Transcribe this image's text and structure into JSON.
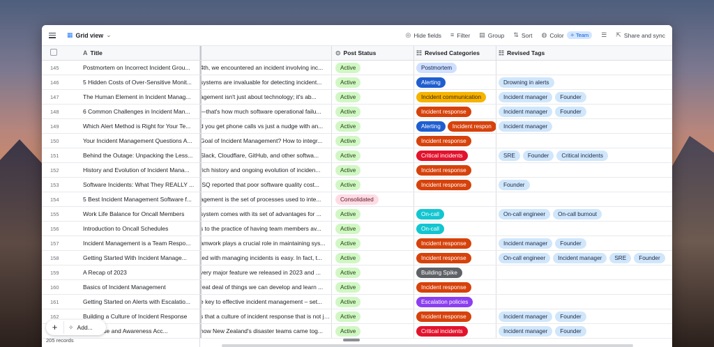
{
  "toolbar": {
    "view_name": "Grid view",
    "hide_fields": "Hide fields",
    "filter": "Filter",
    "group": "Group",
    "sort": "Sort",
    "color": "Color",
    "team_badge": "Team",
    "share": "Share and sync"
  },
  "columns": {
    "title": "Title",
    "status": "Post Status",
    "categories": "Revised Categories",
    "tags": "Revised Tags"
  },
  "rows": [
    {
      "num": "145",
      "title": "Postmortem on Incorrect Incident Grou...",
      "body": "4th, we encountered an incident involving inc...",
      "status": "Active",
      "cats": [
        {
          "t": "Postmortem",
          "c": "p-post"
        }
      ],
      "tags": []
    },
    {
      "num": "146",
      "title": "5 Hidden Costs of Over-Sensitive Monit...",
      "body": "systems are invaluable for detecting incident...",
      "status": "Active",
      "cats": [
        {
          "t": "Alerting",
          "c": "p-alert"
        }
      ],
      "tags": [
        "Drowning in alerts"
      ]
    },
    {
      "num": "147",
      "title": "The Human Element in Incident Manag...",
      "body": "agement isn't just about technology; it's ab...",
      "status": "Active",
      "cats": [
        {
          "t": "Incident communication",
          "c": "p-comm"
        }
      ],
      "tags": [
        "Incident manager",
        "Founder"
      ]
    },
    {
      "num": "148",
      "title": "6 Common Challenges in Incident Man...",
      "body": "—that's how much software operational failu...",
      "status": "Active",
      "cats": [
        {
          "t": "Incident response",
          "c": "p-resp"
        }
      ],
      "tags": [
        "Incident manager",
        "Founder"
      ]
    },
    {
      "num": "149",
      "title": "Which Alert Method is Right for Your Te...",
      "body": "d you get phone calls vs just a nudge with an...",
      "status": "Active",
      "cats": [
        {
          "t": "Alerting",
          "c": "p-alert"
        },
        {
          "t": "Incident respon",
          "c": "p-resp"
        }
      ],
      "tags": [
        "Incident manager"
      ]
    },
    {
      "num": "150",
      "title": "Your Incident Management Questions A...",
      "body": "Goal of Incident Management? How to integr...",
      "status": "Active",
      "cats": [
        {
          "t": "Incident response",
          "c": "p-resp"
        }
      ],
      "tags": []
    },
    {
      "num": "151",
      "title": "Behind the Outage: Unpacking the Less...",
      "body": "Slack, Cloudflare, GitHub, and other softwa...",
      "status": "Active",
      "cats": [
        {
          "t": "Critical incidents",
          "c": "p-crit"
        }
      ],
      "tags": [
        "SRE",
        "Founder",
        "Critical incidents"
      ]
    },
    {
      "num": "152",
      "title": "History and Evolution of Incident Mana...",
      "body": "rich history and ongoing evolution of inciden...",
      "status": "Active",
      "cats": [
        {
          "t": "Incident response",
          "c": "p-resp"
        }
      ],
      "tags": []
    },
    {
      "num": "153",
      "title": "Software Incidents: What They REALLY ...",
      "body": "ISQ reported that poor software quality cost...",
      "status": "Active",
      "cats": [
        {
          "t": "Incident response",
          "c": "p-resp"
        }
      ],
      "tags": [
        "Founder"
      ]
    },
    {
      "num": "154",
      "title": "5 Best Incident Management Software f...",
      "body": "agement is the set of processes used to inte...",
      "status": "Consolidated",
      "cats": [],
      "tags": []
    },
    {
      "num": "155",
      "title": "Work Life Balance for Oncall Members",
      "body": "system comes with its set of advantages for ...",
      "status": "Active",
      "cats": [
        {
          "t": "On-call",
          "c": "p-oncall"
        }
      ],
      "tags": [
        "On-call engineer",
        "On-call burnout"
      ]
    },
    {
      "num": "156",
      "title": "Introduction to Oncall Schedules",
      "body": "s to the practice of having team members av...",
      "status": "Active",
      "cats": [
        {
          "t": "On-call",
          "c": "p-oncall"
        }
      ],
      "tags": []
    },
    {
      "num": "157",
      "title": "Incident Management is a Team Respo...",
      "body": "amwork plays a crucial role in maintaining sys...",
      "status": "Active",
      "cats": [
        {
          "t": "Incident response",
          "c": "p-resp"
        }
      ],
      "tags": [
        "Incident manager",
        "Founder"
      ]
    },
    {
      "num": "158",
      "title": "Getting Started With Incident Manage...",
      "body": "ted with managing incidents is easy. In fact, t...",
      "status": "Active",
      "cats": [
        {
          "t": "Incident response",
          "c": "p-resp"
        }
      ],
      "tags": [
        "On-call engineer",
        "Incident manager",
        "SRE",
        "Founder"
      ]
    },
    {
      "num": "159",
      "title": "A Recap of 2023",
      "body": "very major feature we released in 2023 and ...",
      "status": "Active",
      "cats": [
        {
          "t": "Building Spike",
          "c": "p-spike"
        }
      ],
      "tags": []
    },
    {
      "num": "160",
      "title": "Basics of Incident Management",
      "body": "reat deal of things we can develop and learn ...",
      "status": "Active",
      "cats": [
        {
          "t": "Incident response",
          "c": "p-resp"
        }
      ],
      "tags": []
    },
    {
      "num": "161",
      "title": "Getting Started on Alerts with Escalatio...",
      "body": "e key to effective incident management – set...",
      "status": "Active",
      "cats": [
        {
          "t": "Escalation policies",
          "c": "p-esc"
        }
      ],
      "tags": []
    },
    {
      "num": "162",
      "title": "Building a Culture of Incident Response",
      "body": "s that a culture of incident response that is not ju...",
      "status": "Active",
      "cats": [
        {
          "t": "Incident response",
          "c": "p-resp"
        }
      ],
      "tags": [
        "Incident manager",
        "Founder"
      ]
    },
    {
      "num": "",
      "title": "Response and Awareness Acc...",
      "body": "how New Zealand's disaster teams came tog...",
      "status": "Active",
      "cats": [
        {
          "t": "Critical incidents",
          "c": "p-crit"
        }
      ],
      "tags": [
        "Incident manager",
        "Founder"
      ]
    }
  ],
  "footer": {
    "add_label": "Add...",
    "records": "205 records"
  }
}
